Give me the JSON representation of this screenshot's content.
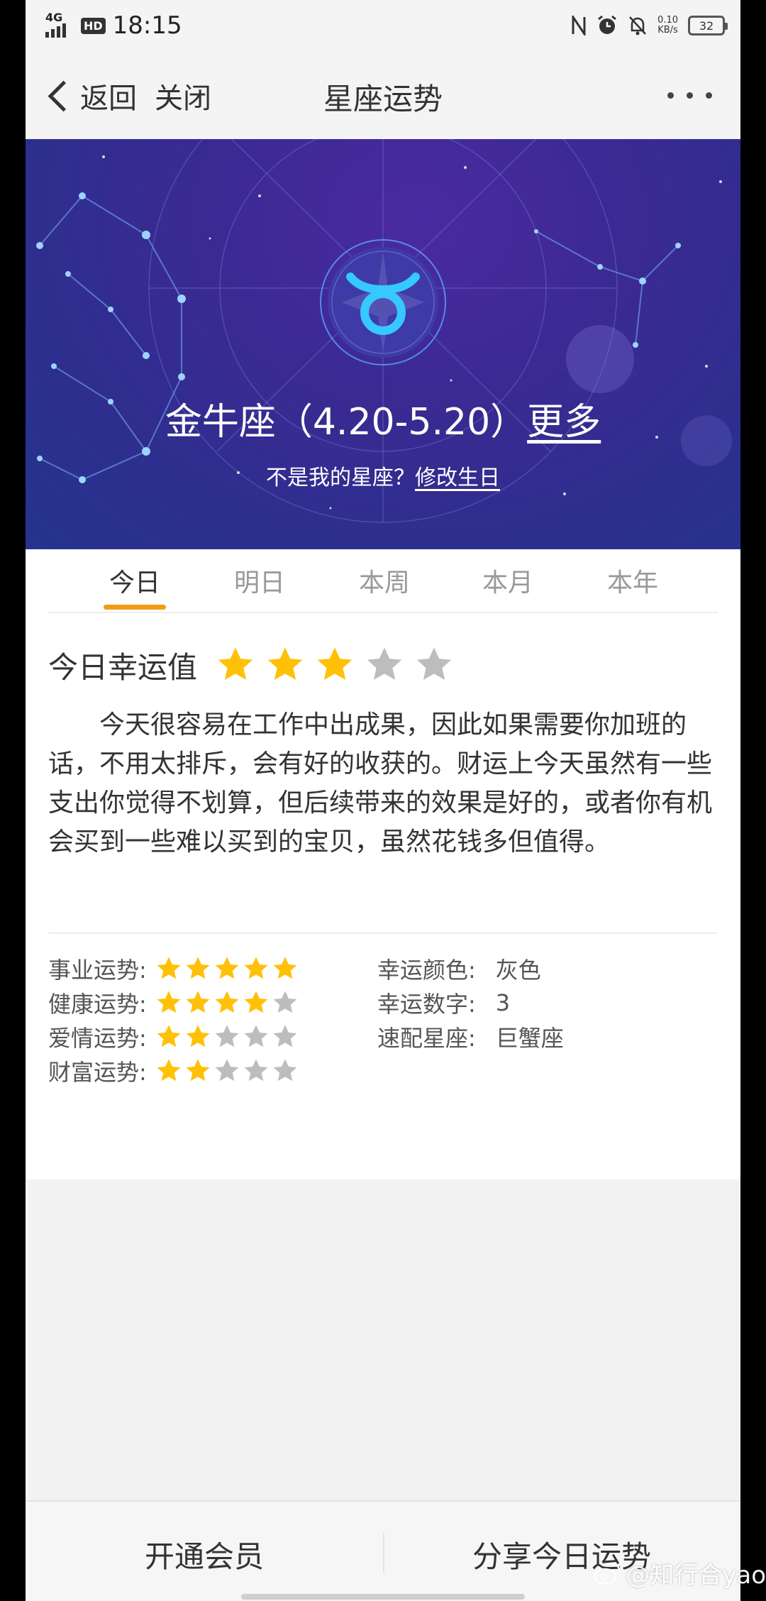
{
  "status": {
    "network": "4G",
    "hd": "HD",
    "time": "18:15",
    "speed_value": "0.10",
    "speed_unit": "KB/s",
    "battery": "32"
  },
  "nav": {
    "back_label": "返回",
    "close_label": "关闭",
    "title": "星座运势"
  },
  "banner": {
    "sign_title": "金牛座（4.20-5.20）",
    "more_link": "更多",
    "sub_text": "不是我的星座？",
    "edit_link": "修改生日"
  },
  "tabs": [
    {
      "label": "今日"
    },
    {
      "label": "明日"
    },
    {
      "label": "本周"
    },
    {
      "label": "本月"
    },
    {
      "label": "本年"
    }
  ],
  "active_tab": "今日",
  "lucky": {
    "label": "今日幸运值",
    "stars": 3,
    "max_stars": 5
  },
  "description": "今天很容易在工作中出成果，因此如果需要你加班的话，不用太排斥，会有好的收获的。财运上今天虽然有一些支出你觉得不划算，但后续带来的效果是好的，或者你有机会买到一些难以买到的宝贝，虽然花钱多但值得。",
  "fortunes": [
    {
      "label": "事业运势:",
      "stars": 5
    },
    {
      "label": "健康运势:",
      "stars": 4
    },
    {
      "label": "爱情运势:",
      "stars": 2
    },
    {
      "label": "财富运势:",
      "stars": 2
    }
  ],
  "lucky_items": [
    {
      "label": "幸运颜色:",
      "value": "灰色"
    },
    {
      "label": "幸运数字:",
      "value": "3"
    },
    {
      "label": "速配星座:",
      "value": "巨蟹座"
    }
  ],
  "bottom": {
    "member_button": "开通会员",
    "share_button": "分享今日运势"
  },
  "watermark": "@知行合yao",
  "colors": {
    "star_on": "#FFC107",
    "star_off": "#BDBDBD",
    "tab_indicator": "#F39C12",
    "banner": "#2C2F8E"
  }
}
